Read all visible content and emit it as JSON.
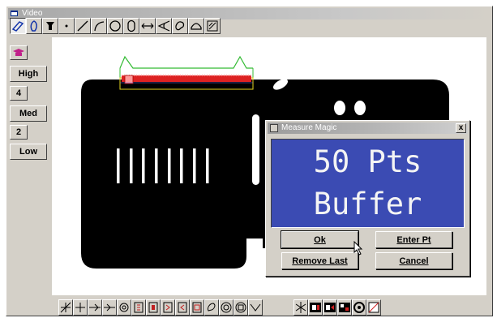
{
  "window": {
    "title": "Video"
  },
  "sidebar": {
    "buttons": [
      {
        "label": "High"
      },
      {
        "label": "4"
      },
      {
        "label": "Med"
      },
      {
        "label": "2"
      },
      {
        "label": "Low"
      }
    ]
  },
  "dialog": {
    "title": "Measure Magic",
    "close_label": "x",
    "display_line1": "50 Pts",
    "display_line2": "Buffer",
    "ok_label": "Ok",
    "enter_pt_label": "Enter Pt",
    "remove_last_label": "Remove Last",
    "cancel_label": "Cancel"
  },
  "toolbar_icons": [
    "window-select-icon",
    "wand-icon",
    "cup-icon",
    "point-icon",
    "line-icon",
    "arc-icon",
    "circle-icon",
    "slot-icon",
    "distance-icon",
    "angle-icon",
    "blob-icon",
    "arch-icon",
    "report-icon"
  ],
  "bottom_icons": [
    "crosshair-icon",
    "cross-icon",
    "arrow-icon",
    "arrow2-icon",
    "target-icon",
    "box1-icon",
    "box2-icon",
    "box3-icon",
    "box4-icon",
    "box5-icon",
    "pen-icon",
    "circles-icon",
    "square-circle-icon",
    "check-icon",
    "star-icon",
    "bw1-icon",
    "bw2-icon",
    "bw3-icon",
    "ring-icon",
    "diag-icon"
  ],
  "colors": {
    "accent_blue": "#3b4bb3",
    "part_black": "#000000",
    "edge_red": "#dd2222",
    "outline_green": "#33bb33"
  }
}
